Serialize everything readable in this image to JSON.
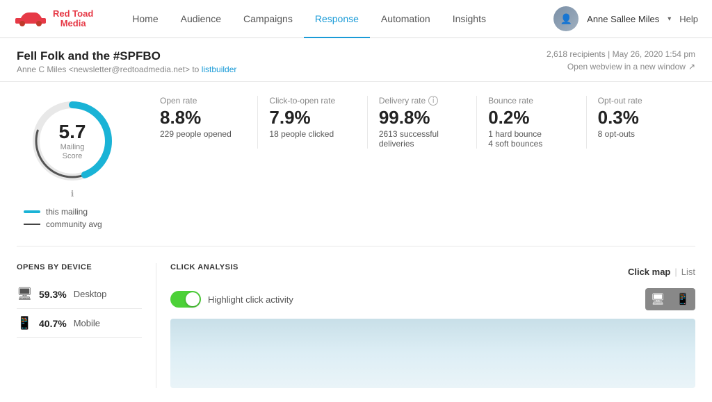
{
  "nav": {
    "logo_line1": "Red Toad",
    "logo_line2": "Media",
    "links": [
      "Home",
      "Audience",
      "Campaigns",
      "Response",
      "Automation",
      "Insights"
    ],
    "active_link": "Response",
    "user_name": "Anne Sallee Miles",
    "help": "Help"
  },
  "subheader": {
    "title": "Fell Folk and the #SPFBO",
    "sender": "Anne C Miles <newsletter@redtoadmedia.net>",
    "to_label": "to",
    "list_link": "listbuilder",
    "recipients": "2,618 recipients",
    "date": "May 26, 2020 1:54 pm",
    "webview": "Open webview in a new window"
  },
  "score": {
    "value": "5.7",
    "label": "Mailing\nScore",
    "legend_this": "this mailing",
    "legend_avg": "community avg"
  },
  "metrics": [
    {
      "label": "Open rate",
      "value": "8.8%",
      "sub": "229 people opened",
      "has_info": false
    },
    {
      "label": "Click-to-open rate",
      "value": "7.9%",
      "sub": "18 people clicked",
      "has_info": false
    },
    {
      "label": "Delivery rate",
      "value": "99.8%",
      "sub": "2613 successful deliveries",
      "has_info": true
    },
    {
      "label": "Bounce rate",
      "value": "0.2%",
      "sub": "1 hard bounce",
      "sub2": "4 soft bounces",
      "has_info": false
    },
    {
      "label": "Opt-out rate",
      "value": "0.3%",
      "sub": "8 opt-outs",
      "has_info": false
    }
  ],
  "opens_by_device": {
    "title": "OPENS BY DEVICE",
    "items": [
      {
        "icon": "🖥",
        "pct": "59.3%",
        "name": "Desktop"
      },
      {
        "icon": "📱",
        "pct": "40.7%",
        "name": "Mobile"
      }
    ]
  },
  "click_analysis": {
    "title": "CLICK ANALYSIS",
    "view_link_active": "Click map",
    "view_link": "List",
    "toggle_label": "Highlight click activity",
    "toggle_on": true
  }
}
